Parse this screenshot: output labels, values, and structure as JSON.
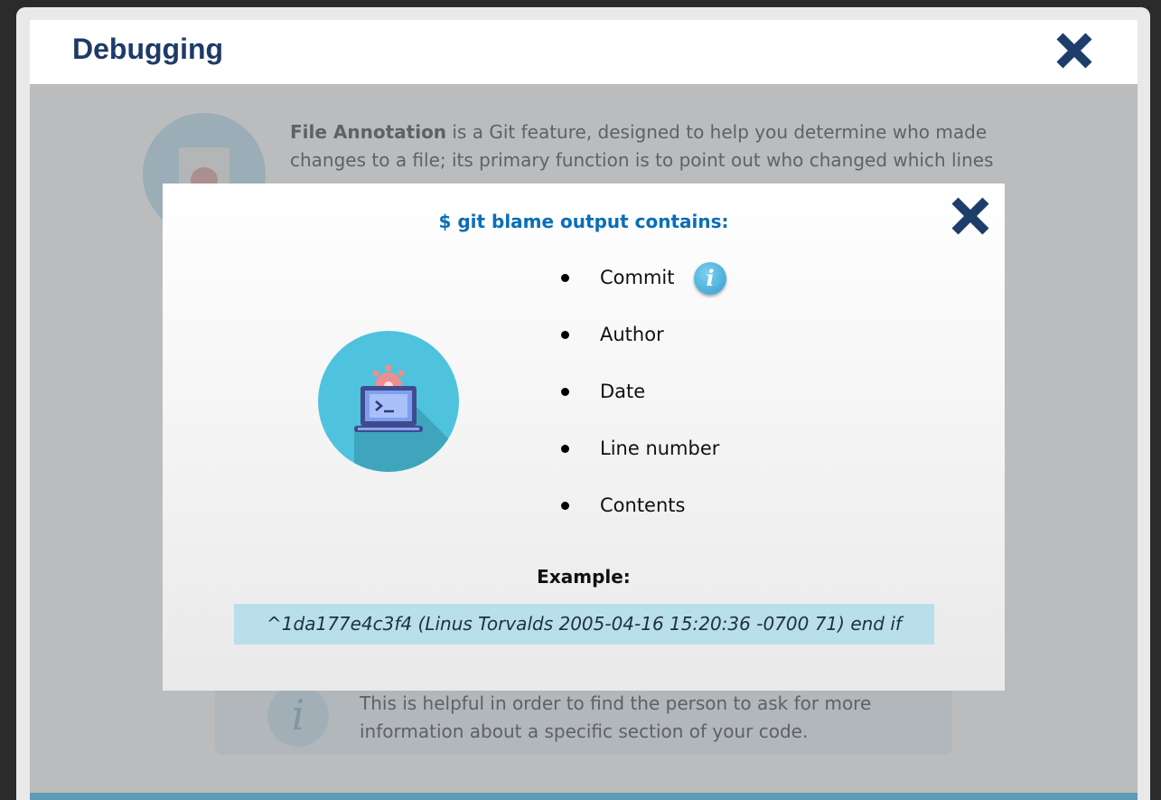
{
  "window": {
    "title": "Debugging",
    "close_icon": "close-x-icon"
  },
  "background": {
    "paragraph_bold": "File Annotation",
    "paragraph_rest": " is a Git feature, designed to help you determine who made changes to a file; its primary function is to point out who changed which lines",
    "icon": "bug-document-icon",
    "note_text": "This is helpful in order to find the person to ask for more information about a specific section of your code.",
    "note_icon": "info-icon"
  },
  "modal": {
    "title": "$ git blame output contains:",
    "close_icon": "close-x-icon",
    "illustration": "laptop-terminal-gear-icon",
    "items": [
      {
        "label": "Commit",
        "has_info": true,
        "info_glyph": "i"
      },
      {
        "label": "Author"
      },
      {
        "label": "Date"
      },
      {
        "label": "Line number"
      },
      {
        "label": "Contents"
      }
    ],
    "example_label": "Example:",
    "example_text": "^1da177e4c3f4 (Linus Torvalds 2005-04-16 15:20:36 -0700 71) end if"
  },
  "colors": {
    "title": "#1e3a68",
    "modal_title": "#0a6eb8",
    "close_icon": "#1e3d6b",
    "example_box": "#b9dfeb",
    "accent_bar": "#55b9e2",
    "illustration_circle": "#4fc3dd"
  }
}
